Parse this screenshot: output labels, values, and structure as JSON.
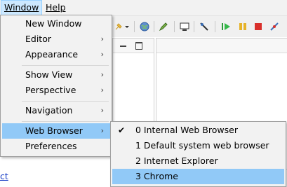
{
  "menubar": {
    "items": [
      {
        "label": "Window"
      },
      {
        "label": "Help"
      }
    ]
  },
  "window_menu": {
    "items": [
      {
        "label": "New Window"
      },
      {
        "label": "Editor"
      },
      {
        "label": "Appearance"
      },
      {
        "label": "Show View"
      },
      {
        "label": "Perspective"
      },
      {
        "label": "Navigation"
      },
      {
        "label": "Web Browser"
      },
      {
        "label": "Preferences"
      }
    ]
  },
  "web_browser_submenu": {
    "items": [
      {
        "label": "0 Internal Web Browser",
        "checked": true
      },
      {
        "label": "1 Default system web browser"
      },
      {
        "label": "2 Internet Explorer"
      },
      {
        "label": "3 Chrome"
      }
    ],
    "highlighted": "3 Chrome"
  },
  "bottom_link": {
    "label": "ct"
  },
  "colors": {
    "highlight": "#91c9f7",
    "menu_bg": "#f2f2f2",
    "menubar_active": "#cce8ff"
  },
  "toolbar_icons": [
    "pin-icon",
    "dropdown-arrow-icon",
    "globe-icon",
    "edit-icon",
    "monitor-icon",
    "brush-icon",
    "run-icon",
    "pause-icon",
    "stop-icon",
    "disconnect-icon"
  ]
}
